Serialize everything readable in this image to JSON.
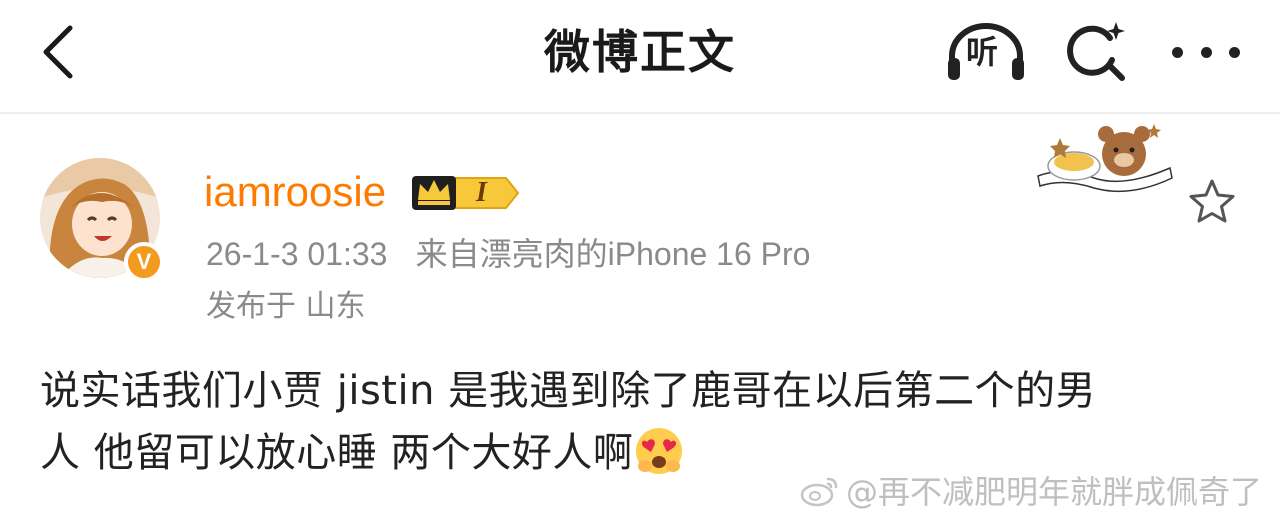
{
  "header": {
    "title": "微博正文",
    "listen_label": "听",
    "icons": {
      "back": "chevron-left-icon",
      "listen": "headphones-icon",
      "search": "search-icon",
      "more": "more-dots-icon"
    }
  },
  "post": {
    "username": "iamroosie",
    "member_level": "I",
    "time": "26-1-3 01:33",
    "source": "来自漂亮肉的iPhone 16 Pro",
    "location": "发布于 山东",
    "text_lines": [
      "说实话我们小贾 jistin 是我遇到除了鹿哥在以后第二个的男",
      "人 他留可以放心睡 两个大好人啊"
    ],
    "emoji": "heart-eyes-emoji",
    "verified_badge": "V"
  },
  "watermark": {
    "text": "@再不减肥明年就胖成佩奇了"
  },
  "colors": {
    "username": "#ff7b00",
    "meta": "#8a8a8a",
    "verified": "#f29b1f",
    "title": "#1a1a1a"
  }
}
